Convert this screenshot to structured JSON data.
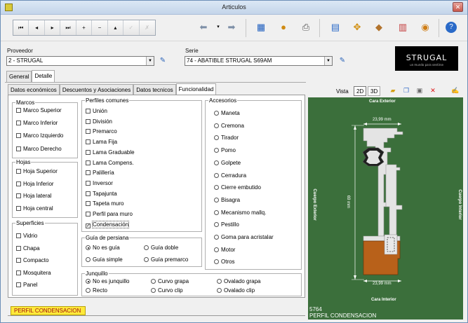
{
  "window": {
    "title": "Articulos"
  },
  "toolbar": {
    "nav": [
      {
        "name": "first-record-button",
        "glyph": "⏮",
        "enabled": true
      },
      {
        "name": "prev-record-button",
        "glyph": "◂",
        "enabled": true
      },
      {
        "name": "next-record-button",
        "glyph": "▸",
        "enabled": true
      },
      {
        "name": "last-record-button",
        "glyph": "⏭",
        "enabled": true
      },
      {
        "name": "add-record-button",
        "glyph": "+",
        "enabled": true
      },
      {
        "name": "delete-record-button",
        "glyph": "−",
        "enabled": true
      },
      {
        "name": "up-button",
        "glyph": "▴",
        "enabled": true
      },
      {
        "name": "confirm-button",
        "glyph": "✓",
        "enabled": false
      },
      {
        "name": "cancel-button",
        "glyph": "✗",
        "enabled": false
      }
    ]
  },
  "proveedor": {
    "label": "Proveedor",
    "value": "2 - STRUGAL"
  },
  "serie": {
    "label": "Serie",
    "value": "74 - ABATIBLE STRUGAL S69AM"
  },
  "logo": {
    "text": "STRUGAL",
    "tagline": "un mundo para sentirse"
  },
  "tabs": [
    {
      "label": "General",
      "selected": false
    },
    {
      "label": "Detalle",
      "selected": true
    }
  ],
  "subtabs": [
    {
      "label": "Datos económicos",
      "selected": false
    },
    {
      "label": "Descuentos y Asociaciones",
      "selected": false
    },
    {
      "label": "Datos tecnicos",
      "selected": false
    },
    {
      "label": "Funcionalidad",
      "selected": true
    }
  ],
  "groups": {
    "marcos": {
      "title": "Marcos",
      "items": [
        "Marco Superior",
        "Marco Inferior",
        "Marco Izquierdo",
        "Marco Derecho"
      ]
    },
    "hojas": {
      "title": "Hojas",
      "items": [
        "Hoja Superior",
        "Hoja Inferior",
        "Hoja lateral",
        "Hoja central"
      ]
    },
    "superficies": {
      "title": "Superficies",
      "items": [
        "Vidrio",
        "Chapa",
        "Compacto",
        "Mosquitera",
        "Panel"
      ]
    },
    "perfiles": {
      "title": "Perfiles comunes",
      "items": [
        "Unión",
        "División",
        "Premarco",
        "Lama Fija",
        "Lama Graduable",
        "Lama Compens.",
        "Palillería",
        "Inversor",
        "Tapajunta",
        "Tapeta muro",
        "Perfil para muro",
        "Condensación"
      ],
      "checked_index": 11
    },
    "accesorios": {
      "title": "Accesorios",
      "items": [
        "Maneta",
        "Cremona",
        "Tirador",
        "Pomo",
        "Golpete",
        "Cerradura",
        "Cierre embutido",
        "Bisagra",
        "Mecanismo mallq.",
        "Pestillo",
        "Goma para acristalar",
        "Motor",
        "Otros"
      ]
    },
    "guia": {
      "title": "Guía de persiana",
      "options": [
        "No es guía",
        "Guía doble",
        "Guía simple",
        "Guía premarco"
      ],
      "selected_index": 0
    },
    "junquillo": {
      "title": "Junquillo",
      "options": [
        "No es junquillo",
        "Curvo grapa",
        "Ovalado grapa",
        "Recto",
        "Curvo clip",
        "Ovalado clip"
      ],
      "selected_index": 0
    }
  },
  "viewer": {
    "vista_label": "Vista",
    "btn_2d": "2D",
    "btn_3d": "3D",
    "cara_exterior": "Cara Exterior",
    "cara_interior": "Cara Interior",
    "cuerpo_exterior": "Cuerpo Exterior",
    "cuerpo_interior": "Cuerpo Interior",
    "dim_top": "23,99 mm",
    "dim_bottom": "23,99 mm",
    "dim_height": "69 mm",
    "code": "5764",
    "name": "PERFIL CONDENSACION",
    "background": "#3b6f3b",
    "profile_color": "#b8611a"
  },
  "bottom_tab": {
    "label": "PERFIL CONDENSACION"
  }
}
